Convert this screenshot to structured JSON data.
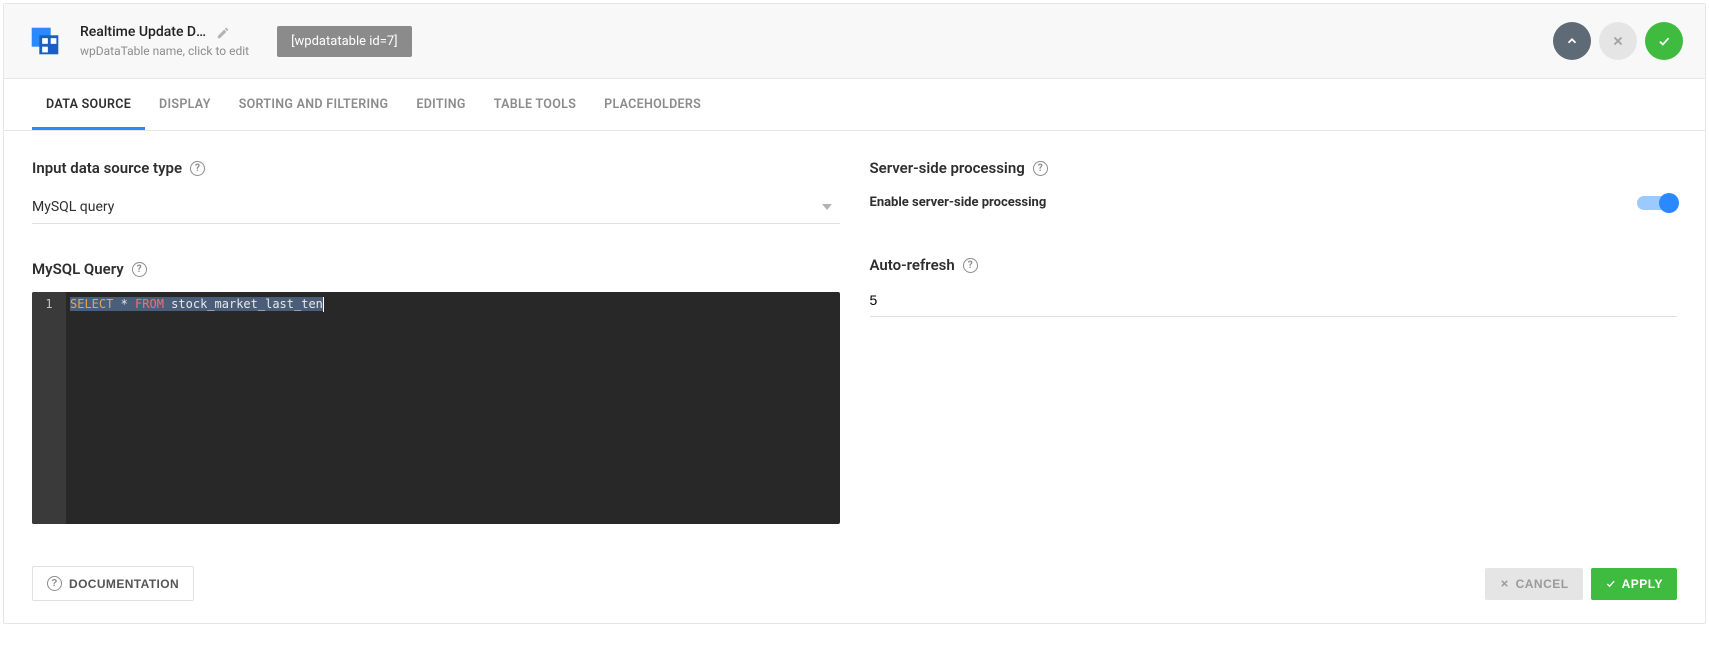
{
  "header": {
    "title": "Realtime Update Demo",
    "subtitle": "wpDataTable name, click to edit",
    "shortcode": "[wpdatatable id=7]"
  },
  "tabs": {
    "items": [
      {
        "label": "DATA SOURCE",
        "active": true
      },
      {
        "label": "DISPLAY",
        "active": false
      },
      {
        "label": "SORTING AND FILTERING",
        "active": false
      },
      {
        "label": "EDITING",
        "active": false
      },
      {
        "label": "TABLE TOOLS",
        "active": false
      },
      {
        "label": "PLACEHOLDERS",
        "active": false
      }
    ]
  },
  "data_source": {
    "section_label": "Input data source type",
    "select_value": "MySQL query",
    "query_label": "MySQL Query",
    "code": {
      "keyword1": "SELECT",
      "star": " * ",
      "keyword2": "FROM",
      "table": " stock_market_last_ten"
    },
    "line_number": "1"
  },
  "server_side": {
    "section_label": "Server-side processing",
    "toggle_label": "Enable server-side processing",
    "enabled": true
  },
  "auto_refresh": {
    "section_label": "Auto-refresh",
    "value": "5"
  },
  "footer": {
    "documentation": "DOCUMENTATION",
    "cancel": "CANCEL",
    "apply": "APPLY"
  }
}
